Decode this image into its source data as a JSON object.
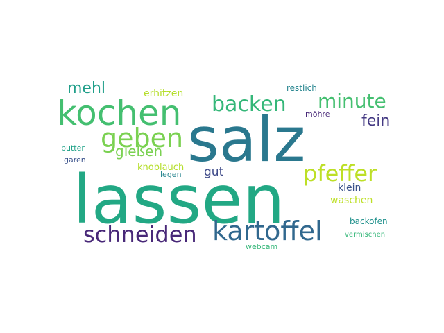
{
  "words": [
    {
      "id": "salz",
      "text": "salz",
      "color": "#2a788e"
    },
    {
      "id": "lassen",
      "text": "lassen",
      "color": "#22a884"
    },
    {
      "id": "kochen",
      "text": "kochen",
      "color": "#44bf70"
    },
    {
      "id": "kartoffel",
      "text": "kartoffel",
      "color": "#31688e"
    },
    {
      "id": "schneiden",
      "text": "schneiden",
      "color": "#482878"
    },
    {
      "id": "geben",
      "text": "geben",
      "color": "#7ad151"
    },
    {
      "id": "pfeffer",
      "text": "pfeffer",
      "color": "#bddf26"
    },
    {
      "id": "backen",
      "text": "backen",
      "color": "#35b779"
    },
    {
      "id": "minute",
      "text": "minute",
      "color": "#44bf70"
    },
    {
      "id": "mehl",
      "text": "mehl",
      "color": "#1f9e89"
    },
    {
      "id": "fein",
      "text": "fein",
      "color": "#443983"
    },
    {
      "id": "giessen",
      "text": "gießen",
      "color": "#7ad151"
    },
    {
      "id": "gut",
      "text": "gut",
      "color": "#3e4a89"
    },
    {
      "id": "erhitzen",
      "text": "erhitzen",
      "color": "#b5de2b"
    },
    {
      "id": "knoblauch",
      "text": "knoblauch",
      "color": "#b5de2b"
    },
    {
      "id": "restlich",
      "text": "restlich",
      "color": "#25848e"
    },
    {
      "id": "klein",
      "text": "klein",
      "color": "#3b528b"
    },
    {
      "id": "waschen",
      "text": "waschen",
      "color": "#bddf26"
    },
    {
      "id": "backofen",
      "text": "backofen",
      "color": "#21918c"
    },
    {
      "id": "butter",
      "text": "butter",
      "color": "#1fa187"
    },
    {
      "id": "garen",
      "text": "garen",
      "color": "#3b528b"
    },
    {
      "id": "moehre",
      "text": "möhre",
      "color": "#482878"
    },
    {
      "id": "legen",
      "text": "legen",
      "color": "#25848e"
    },
    {
      "id": "vermischen",
      "text": "vermischen",
      "color": "#35b779"
    },
    {
      "id": "webcam",
      "text": "webcam",
      "color": "#35b779"
    }
  ]
}
